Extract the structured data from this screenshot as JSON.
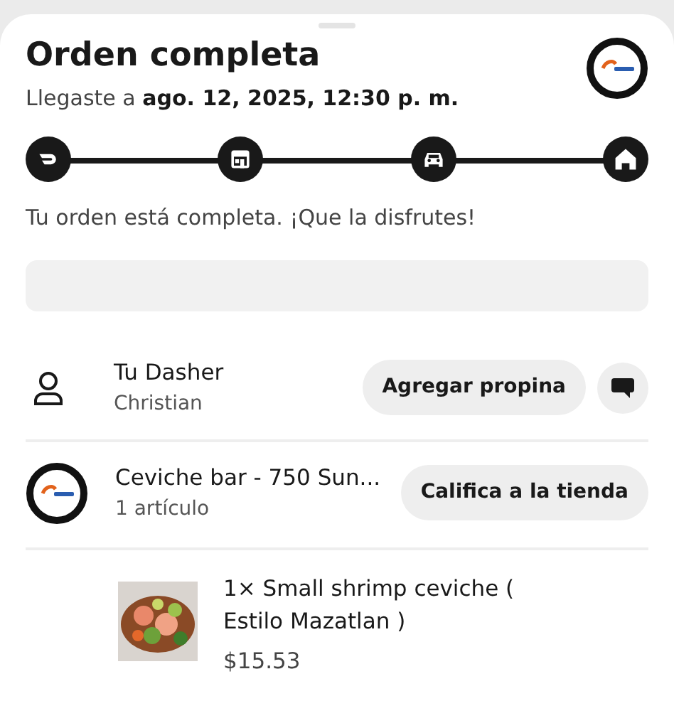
{
  "header": {
    "title": "Orden completa",
    "subtitle_prefix": "Llegaste a",
    "subtitle_time": "ago. 12, 2025, 12:30 p. m."
  },
  "steps": [
    {
      "kind": "dasher"
    },
    {
      "kind": "store"
    },
    {
      "kind": "car"
    },
    {
      "kind": "home"
    }
  ],
  "message": "Tu orden está completa. ¡Que la disfrutes!",
  "dasher": {
    "title": "Tu Dasher",
    "name": "Christian",
    "tip_button": "Agregar propina"
  },
  "store": {
    "name": "Ceviche bar - 750 Sun...",
    "count": "1 artículo",
    "rate_button": "Califica a la tienda"
  },
  "items": [
    {
      "kind": "picture",
      "text": "1× Small shrimp ceviche ( Estilo Mazatlan )",
      "price": "$15.53"
    }
  ]
}
